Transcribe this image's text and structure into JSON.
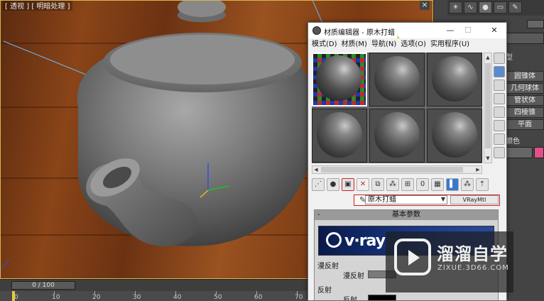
{
  "viewport": {
    "label": "[ 透视 ] [ 明暗处理 ]",
    "close_glyph": "×"
  },
  "timeline": {
    "slider_text": "0 / 100",
    "tick_labels": [
      "0",
      "10",
      "20",
      "30",
      "40",
      "50",
      "60",
      "70"
    ]
  },
  "command_panel": {
    "tab_icons": [
      "sun-icon",
      "curves-icon",
      "dot-icon",
      "monitor-icon",
      "wrench-icon"
    ],
    "section_heading": "型",
    "object_buttons": [
      "圆锥体",
      "几何球体",
      "管状体",
      "四棱锥",
      "平面"
    ],
    "color_label": "颜色",
    "color_swatch": "#e0508a"
  },
  "material_editor": {
    "title": "材质编辑器 - 原木打蜡",
    "window_buttons": {
      "minimize": "—",
      "maximize": "☐",
      "close": "✕"
    },
    "menu": [
      "模式(D)",
      "材质(M)",
      "导航(N)",
      "选项(O)",
      "实用程序(U)"
    ],
    "slot_count": 6,
    "toolbar_icons": [
      "get-material-icon",
      "put-to-scene-icon",
      "assign-material-icon",
      "delete-icon",
      "make-copy-icon",
      "make-unique-icon",
      "put-to-library-icon",
      "material-id-icon",
      "show-map-icon",
      "show-shaded-icon",
      "show-end-result-icon",
      "go-parent-icon",
      "go-sibling-icon"
    ],
    "material_name": "原木打蜡",
    "material_type": "VRayMtl",
    "rollout_title": "基本参数",
    "vray_logo": "v·ray",
    "diffuse_section": "漫反射",
    "diffuse_label": "漫反射",
    "reflect_section": "反射",
    "reflect_label": "反射"
  },
  "watermark": {
    "title": "溜溜自学",
    "url": "ZIXUE.3D66.COM"
  }
}
